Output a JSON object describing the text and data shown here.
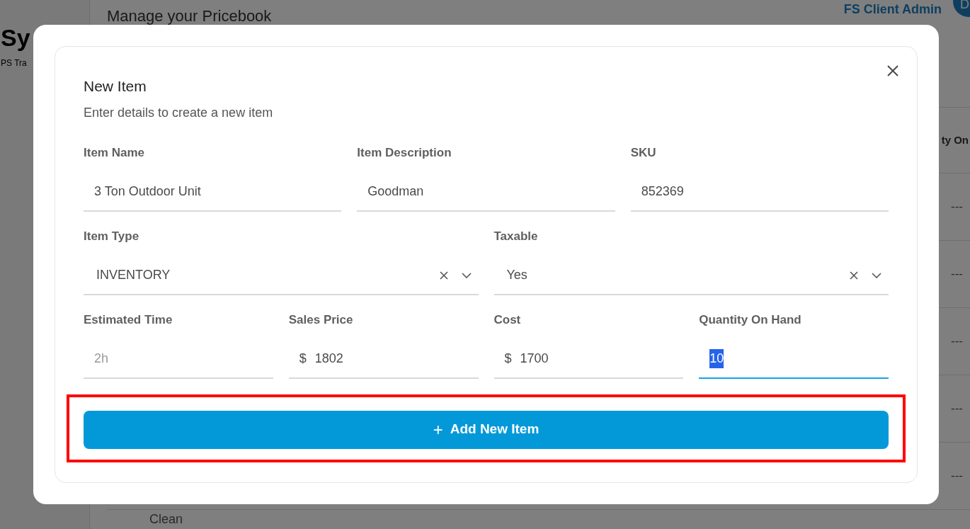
{
  "background": {
    "brand": "Sy",
    "brand_subtitle": "PS Tra",
    "page_title": "Manage your Pricebook",
    "user_name": "FS Client Admin",
    "avatar_initial": "D",
    "table": {
      "column_header": "ty On",
      "cells": [
        "---",
        "---",
        "---",
        "---",
        "---"
      ],
      "row_label": "Clean"
    }
  },
  "modal": {
    "title": "New Item",
    "subtitle": "Enter details to create a new item",
    "rows": [
      [
        {
          "kind": "text",
          "label": "Item Name",
          "value": "3 Ton Outdoor Unit",
          "focused": false
        },
        {
          "kind": "text",
          "label": "Item Description",
          "value": "Goodman",
          "focused": false
        },
        {
          "kind": "text",
          "label": "SKU",
          "value": "852369",
          "focused": false
        }
      ],
      [
        {
          "kind": "select",
          "label": "Item Type",
          "value": "INVENTORY",
          "focused": false
        },
        {
          "kind": "select",
          "label": "Taxable",
          "value": "Yes",
          "focused": false
        }
      ],
      [
        {
          "kind": "text",
          "label": "Estimated Time",
          "placeholder": "2h",
          "focused": false
        },
        {
          "kind": "currency",
          "label": "Sales Price",
          "prefix": "$",
          "value": "1802",
          "focused": false
        },
        {
          "kind": "currency",
          "label": "Cost",
          "prefix": "$",
          "value": "1700",
          "focused": false
        },
        {
          "kind": "text",
          "label": "Quantity On Hand",
          "value": "10",
          "focused": true,
          "text_selected": true
        }
      ]
    ],
    "submit": {
      "icon": "+",
      "label": "Add New Item",
      "highlighted": true
    }
  }
}
